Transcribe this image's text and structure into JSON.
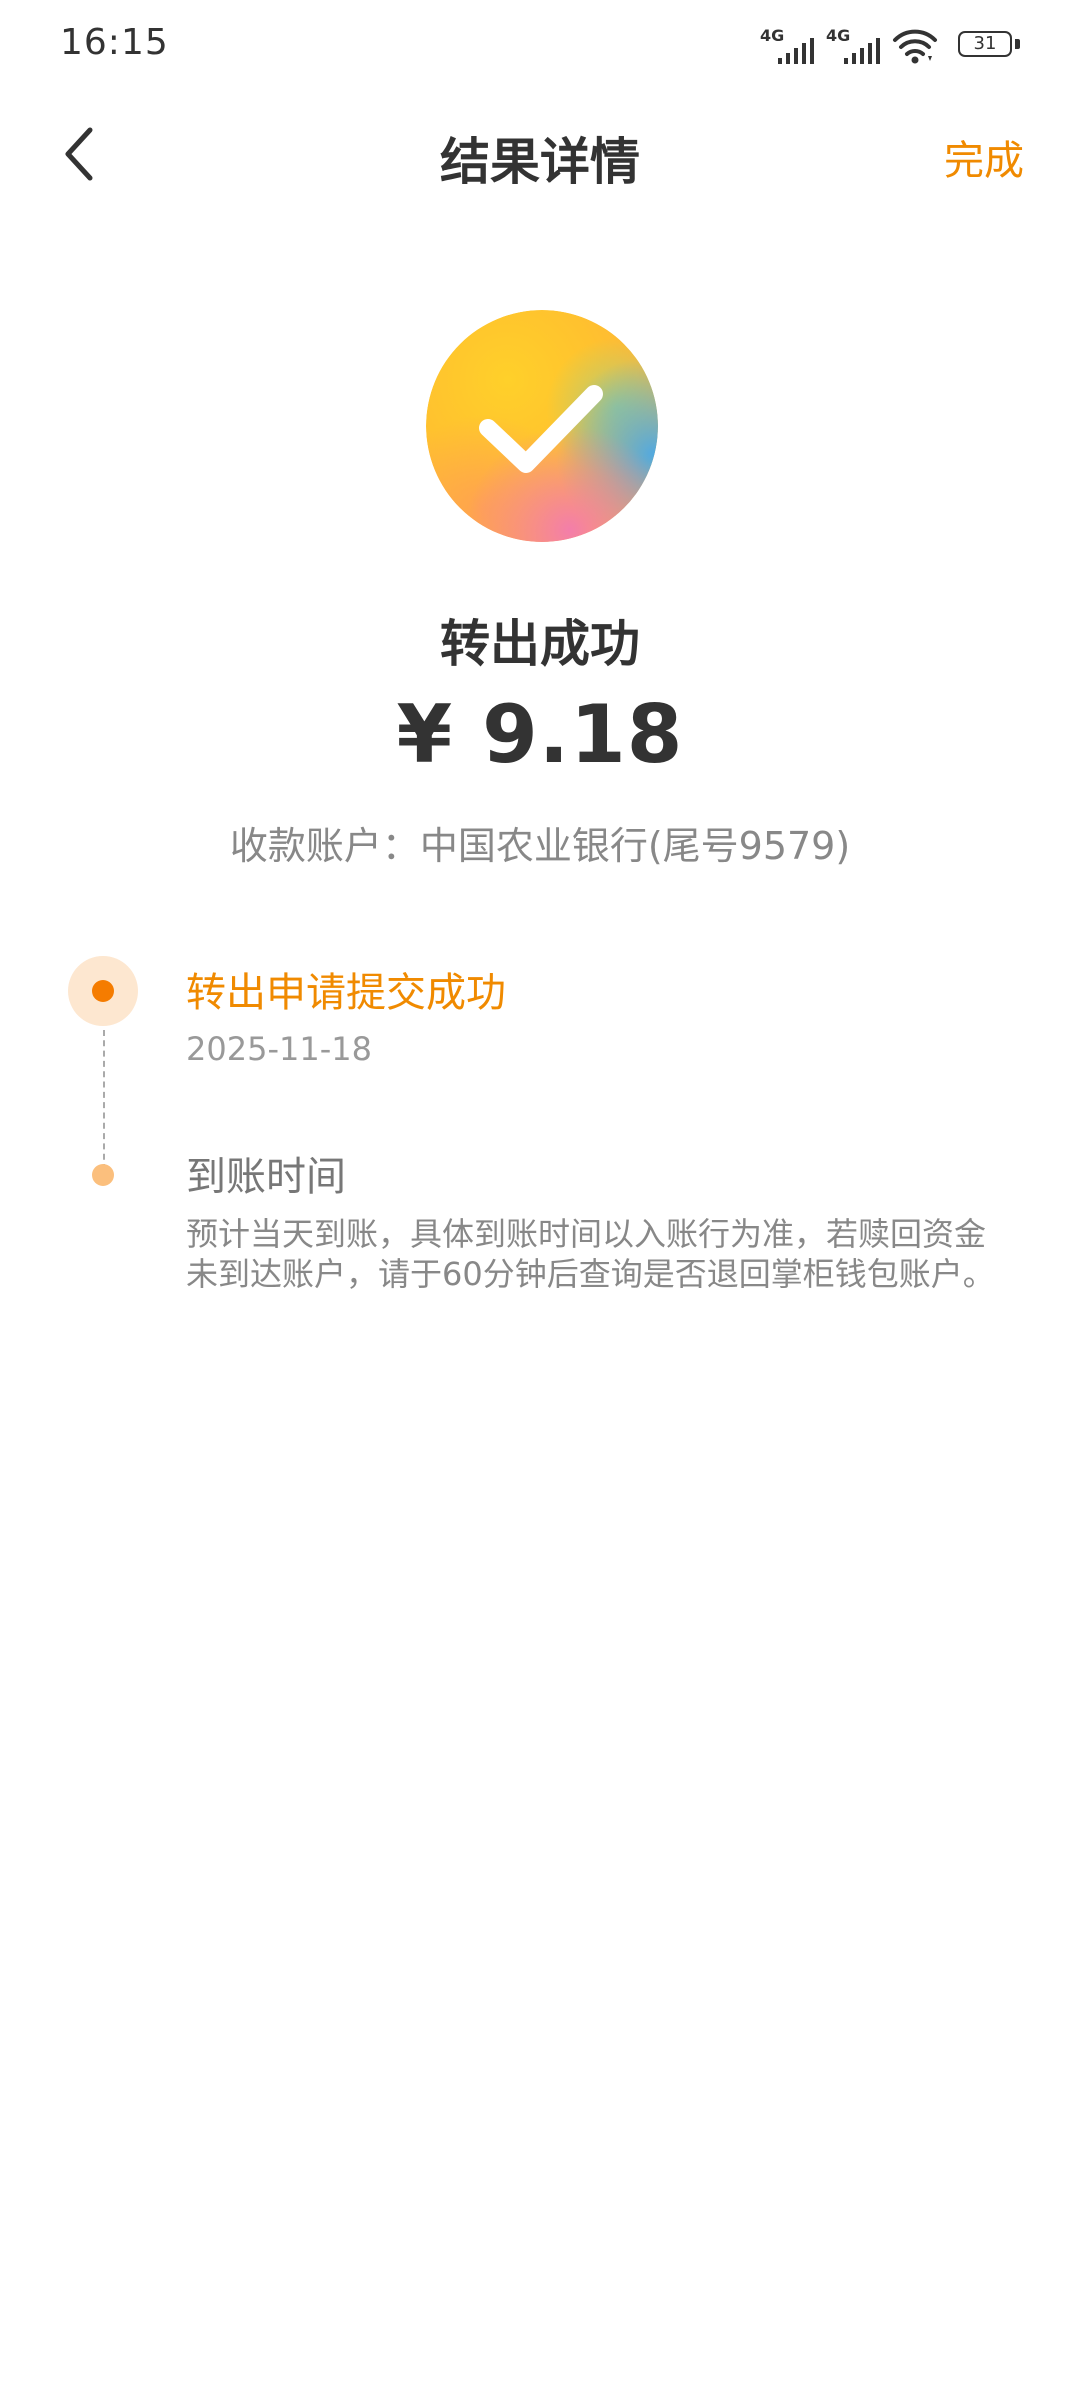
{
  "status_bar": {
    "time": "16:15",
    "network1": "4G",
    "network2": "4G",
    "battery": "31"
  },
  "nav": {
    "title": "结果详情",
    "done_label": "完成"
  },
  "result": {
    "title": "转出成功",
    "amount": "¥ 9.18",
    "account": "收款账户：中国农业银行(尾号9579)"
  },
  "timeline": {
    "steps": [
      {
        "title": "转出申请提交成功",
        "date": "2025-11-18"
      },
      {
        "title": "到账时间",
        "description": "预计当天到账，具体到账时间以入账行为准，若赎回资金未到达账户，请于60分钟后查询是否退回掌柜钱包账户。"
      }
    ]
  },
  "colors": {
    "accent": "#f08a00",
    "active_dot": "#f57c00",
    "pending_dot": "#fbbf7d"
  }
}
